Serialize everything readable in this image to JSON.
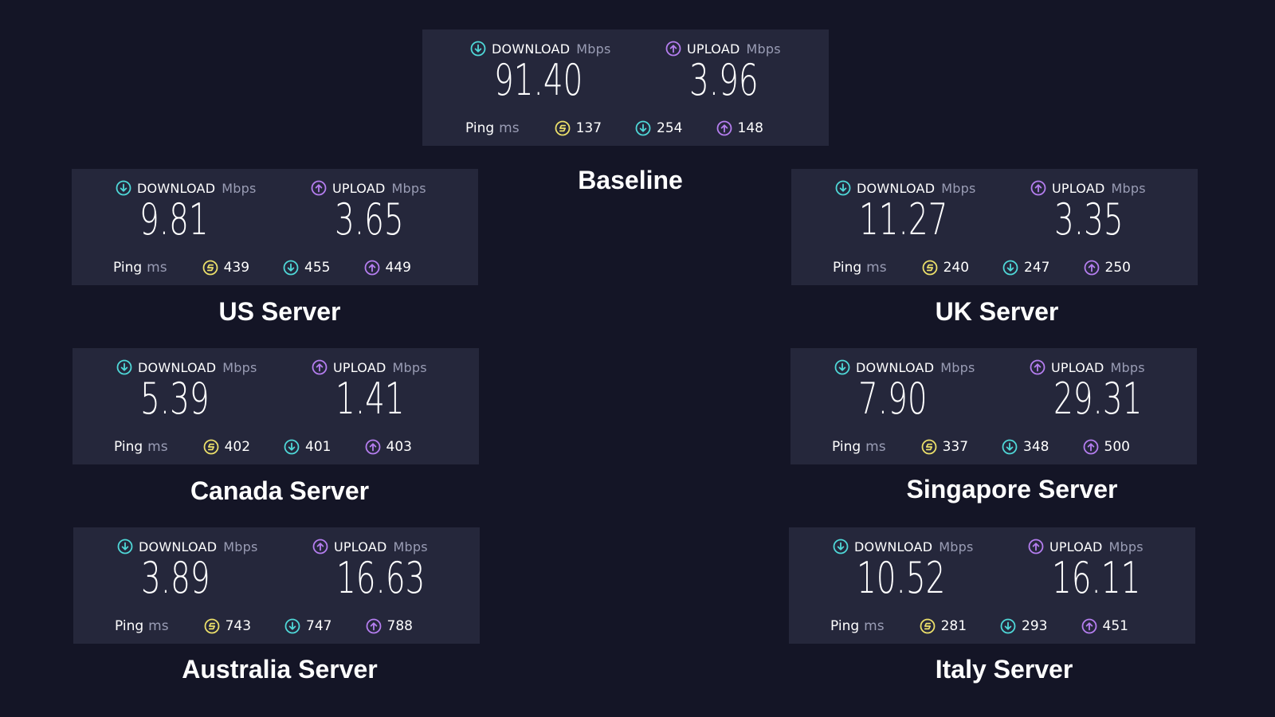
{
  "labels": {
    "download": "DOWNLOAD",
    "upload": "UPLOAD",
    "mbps": "Mbps",
    "ping": "Ping",
    "ms": "ms"
  },
  "colors": {
    "background": "#141526",
    "card": "#25273b",
    "download_icon": "#4fd8d8",
    "upload_icon": "#b57ef0",
    "ping_icon": "#ece06a"
  },
  "icons": {
    "download": "arrow-down-circle-icon",
    "upload": "arrow-up-circle-icon",
    "ping": "latency-circle-icon"
  },
  "cards": [
    {
      "name": "Baseline",
      "download": "91.40",
      "upload": "3.96",
      "ping_idle": "137",
      "ping_download": "254",
      "ping_upload": "148"
    },
    {
      "name": "US Server",
      "download": "9.81",
      "upload": "3.65",
      "ping_idle": "439",
      "ping_download": "455",
      "ping_upload": "449"
    },
    {
      "name": "UK Server",
      "download": "11.27",
      "upload": "3.35",
      "ping_idle": "240",
      "ping_download": "247",
      "ping_upload": "250"
    },
    {
      "name": "Canada Server",
      "download": "5.39",
      "upload": "1.41",
      "ping_idle": "402",
      "ping_download": "401",
      "ping_upload": "403"
    },
    {
      "name": "Singapore Server",
      "download": "7.90",
      "upload": "29.31",
      "ping_idle": "337",
      "ping_download": "348",
      "ping_upload": "500"
    },
    {
      "name": "Australia Server",
      "download": "3.89",
      "upload": "16.63",
      "ping_idle": "743",
      "ping_download": "747",
      "ping_upload": "788"
    },
    {
      "name": "Italy Server",
      "download": "10.52",
      "upload": "16.11",
      "ping_idle": "281",
      "ping_download": "293",
      "ping_upload": "451"
    }
  ]
}
